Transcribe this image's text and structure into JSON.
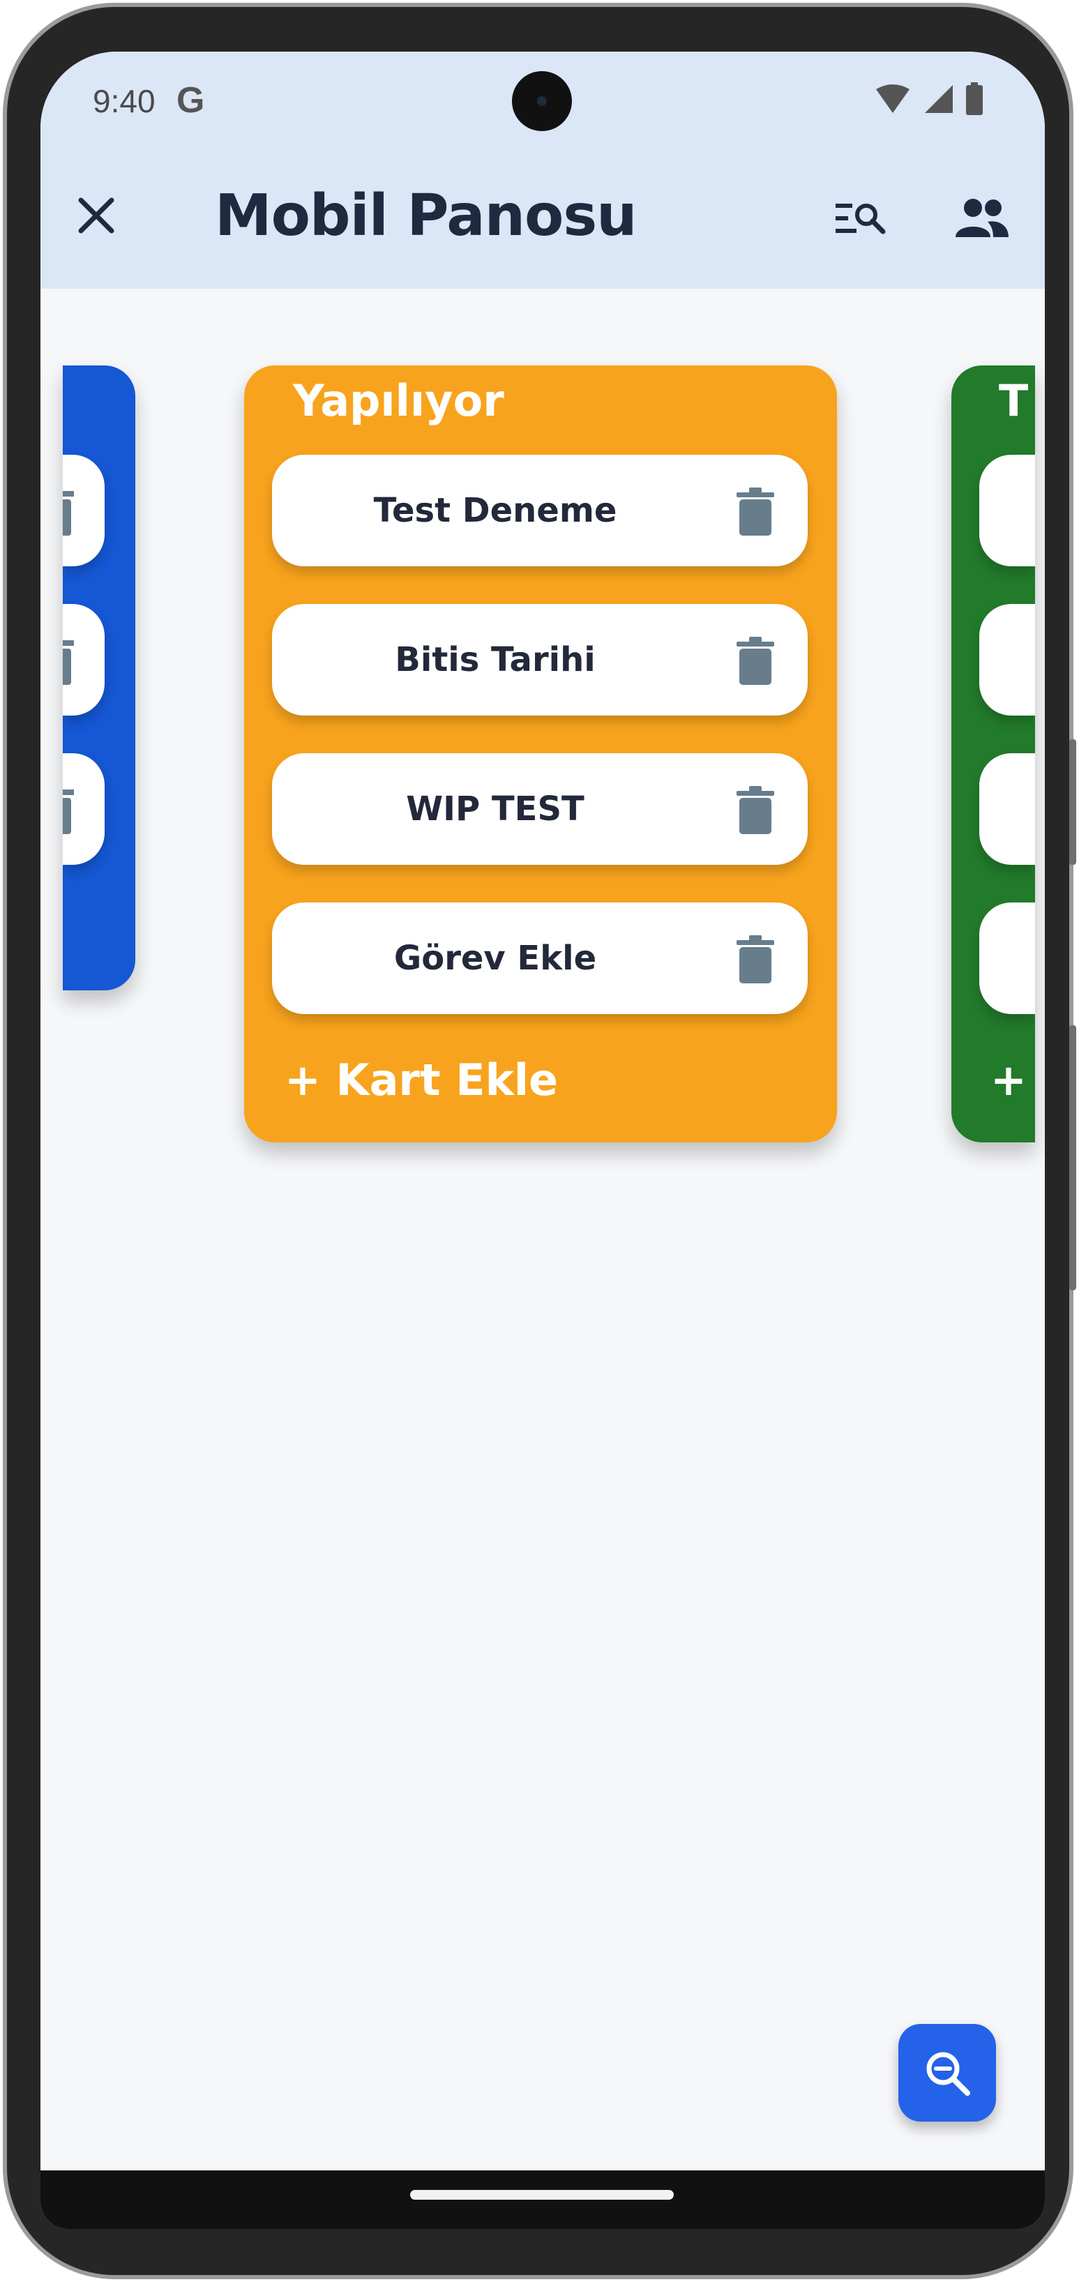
{
  "status_bar": {
    "time": "9:40",
    "google_mark": "G"
  },
  "header": {
    "title": "Mobil Panosu"
  },
  "icons": {
    "close": "close-icon",
    "filter_search": "filter-search-icon",
    "members": "people-icon",
    "trash": "trash-icon",
    "zoom": "zoom-out-icon"
  },
  "colors": {
    "header_bg": "#dbe6f7",
    "todo_column": "#1557d4",
    "in_progress_column": "#f8a31d",
    "done_column": "#227a2b",
    "fab": "#2462e9",
    "trash_icon": "#677d8c"
  },
  "board": {
    "left_column": {
      "visible_cards": 3
    },
    "main_column": {
      "title": "Yapılıyor",
      "cards": [
        {
          "title": "Test Deneme"
        },
        {
          "title": "Bitis Tarihi"
        },
        {
          "title": "WIP TEST"
        },
        {
          "title": "Görev Ekle"
        }
      ],
      "add_card_label": "+ Kart Ekle"
    },
    "right_column": {
      "title_fragment": "T",
      "add_fragment": "+"
    }
  }
}
